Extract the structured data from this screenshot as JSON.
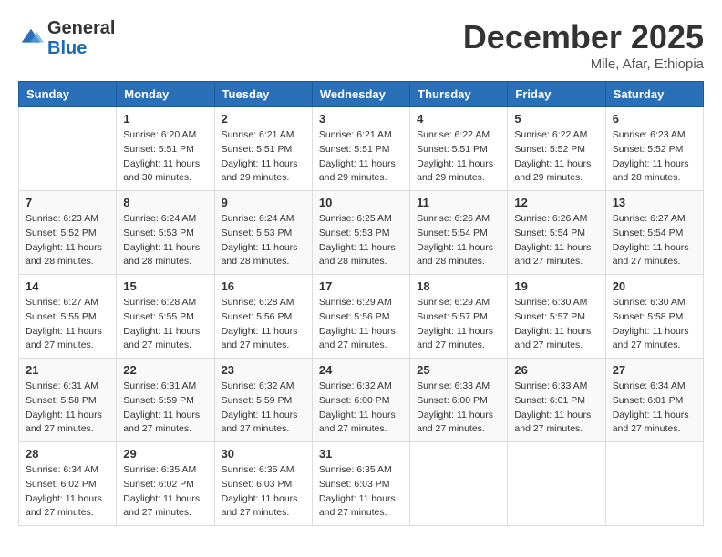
{
  "header": {
    "logo_general": "General",
    "logo_blue": "Blue",
    "month_title": "December 2025",
    "location": "Mile, Afar, Ethiopia"
  },
  "days_of_week": [
    "Sunday",
    "Monday",
    "Tuesday",
    "Wednesday",
    "Thursday",
    "Friday",
    "Saturday"
  ],
  "weeks": [
    [
      {
        "day": "",
        "sunrise": "",
        "sunset": "",
        "daylight": ""
      },
      {
        "day": "1",
        "sunrise": "Sunrise: 6:20 AM",
        "sunset": "Sunset: 5:51 PM",
        "daylight": "Daylight: 11 hours and 30 minutes."
      },
      {
        "day": "2",
        "sunrise": "Sunrise: 6:21 AM",
        "sunset": "Sunset: 5:51 PM",
        "daylight": "Daylight: 11 hours and 29 minutes."
      },
      {
        "day": "3",
        "sunrise": "Sunrise: 6:21 AM",
        "sunset": "Sunset: 5:51 PM",
        "daylight": "Daylight: 11 hours and 29 minutes."
      },
      {
        "day": "4",
        "sunrise": "Sunrise: 6:22 AM",
        "sunset": "Sunset: 5:51 PM",
        "daylight": "Daylight: 11 hours and 29 minutes."
      },
      {
        "day": "5",
        "sunrise": "Sunrise: 6:22 AM",
        "sunset": "Sunset: 5:52 PM",
        "daylight": "Daylight: 11 hours and 29 minutes."
      },
      {
        "day": "6",
        "sunrise": "Sunrise: 6:23 AM",
        "sunset": "Sunset: 5:52 PM",
        "daylight": "Daylight: 11 hours and 28 minutes."
      }
    ],
    [
      {
        "day": "7",
        "sunrise": "Sunrise: 6:23 AM",
        "sunset": "Sunset: 5:52 PM",
        "daylight": "Daylight: 11 hours and 28 minutes."
      },
      {
        "day": "8",
        "sunrise": "Sunrise: 6:24 AM",
        "sunset": "Sunset: 5:53 PM",
        "daylight": "Daylight: 11 hours and 28 minutes."
      },
      {
        "day": "9",
        "sunrise": "Sunrise: 6:24 AM",
        "sunset": "Sunset: 5:53 PM",
        "daylight": "Daylight: 11 hours and 28 minutes."
      },
      {
        "day": "10",
        "sunrise": "Sunrise: 6:25 AM",
        "sunset": "Sunset: 5:53 PM",
        "daylight": "Daylight: 11 hours and 28 minutes."
      },
      {
        "day": "11",
        "sunrise": "Sunrise: 6:26 AM",
        "sunset": "Sunset: 5:54 PM",
        "daylight": "Daylight: 11 hours and 28 minutes."
      },
      {
        "day": "12",
        "sunrise": "Sunrise: 6:26 AM",
        "sunset": "Sunset: 5:54 PM",
        "daylight": "Daylight: 11 hours and 27 minutes."
      },
      {
        "day": "13",
        "sunrise": "Sunrise: 6:27 AM",
        "sunset": "Sunset: 5:54 PM",
        "daylight": "Daylight: 11 hours and 27 minutes."
      }
    ],
    [
      {
        "day": "14",
        "sunrise": "Sunrise: 6:27 AM",
        "sunset": "Sunset: 5:55 PM",
        "daylight": "Daylight: 11 hours and 27 minutes."
      },
      {
        "day": "15",
        "sunrise": "Sunrise: 6:28 AM",
        "sunset": "Sunset: 5:55 PM",
        "daylight": "Daylight: 11 hours and 27 minutes."
      },
      {
        "day": "16",
        "sunrise": "Sunrise: 6:28 AM",
        "sunset": "Sunset: 5:56 PM",
        "daylight": "Daylight: 11 hours and 27 minutes."
      },
      {
        "day": "17",
        "sunrise": "Sunrise: 6:29 AM",
        "sunset": "Sunset: 5:56 PM",
        "daylight": "Daylight: 11 hours and 27 minutes."
      },
      {
        "day": "18",
        "sunrise": "Sunrise: 6:29 AM",
        "sunset": "Sunset: 5:57 PM",
        "daylight": "Daylight: 11 hours and 27 minutes."
      },
      {
        "day": "19",
        "sunrise": "Sunrise: 6:30 AM",
        "sunset": "Sunset: 5:57 PM",
        "daylight": "Daylight: 11 hours and 27 minutes."
      },
      {
        "day": "20",
        "sunrise": "Sunrise: 6:30 AM",
        "sunset": "Sunset: 5:58 PM",
        "daylight": "Daylight: 11 hours and 27 minutes."
      }
    ],
    [
      {
        "day": "21",
        "sunrise": "Sunrise: 6:31 AM",
        "sunset": "Sunset: 5:58 PM",
        "daylight": "Daylight: 11 hours and 27 minutes."
      },
      {
        "day": "22",
        "sunrise": "Sunrise: 6:31 AM",
        "sunset": "Sunset: 5:59 PM",
        "daylight": "Daylight: 11 hours and 27 minutes."
      },
      {
        "day": "23",
        "sunrise": "Sunrise: 6:32 AM",
        "sunset": "Sunset: 5:59 PM",
        "daylight": "Daylight: 11 hours and 27 minutes."
      },
      {
        "day": "24",
        "sunrise": "Sunrise: 6:32 AM",
        "sunset": "Sunset: 6:00 PM",
        "daylight": "Daylight: 11 hours and 27 minutes."
      },
      {
        "day": "25",
        "sunrise": "Sunrise: 6:33 AM",
        "sunset": "Sunset: 6:00 PM",
        "daylight": "Daylight: 11 hours and 27 minutes."
      },
      {
        "day": "26",
        "sunrise": "Sunrise: 6:33 AM",
        "sunset": "Sunset: 6:01 PM",
        "daylight": "Daylight: 11 hours and 27 minutes."
      },
      {
        "day": "27",
        "sunrise": "Sunrise: 6:34 AM",
        "sunset": "Sunset: 6:01 PM",
        "daylight": "Daylight: 11 hours and 27 minutes."
      }
    ],
    [
      {
        "day": "28",
        "sunrise": "Sunrise: 6:34 AM",
        "sunset": "Sunset: 6:02 PM",
        "daylight": "Daylight: 11 hours and 27 minutes."
      },
      {
        "day": "29",
        "sunrise": "Sunrise: 6:35 AM",
        "sunset": "Sunset: 6:02 PM",
        "daylight": "Daylight: 11 hours and 27 minutes."
      },
      {
        "day": "30",
        "sunrise": "Sunrise: 6:35 AM",
        "sunset": "Sunset: 6:03 PM",
        "daylight": "Daylight: 11 hours and 27 minutes."
      },
      {
        "day": "31",
        "sunrise": "Sunrise: 6:35 AM",
        "sunset": "Sunset: 6:03 PM",
        "daylight": "Daylight: 11 hours and 27 minutes."
      },
      {
        "day": "",
        "sunrise": "",
        "sunset": "",
        "daylight": ""
      },
      {
        "day": "",
        "sunrise": "",
        "sunset": "",
        "daylight": ""
      },
      {
        "day": "",
        "sunrise": "",
        "sunset": "",
        "daylight": ""
      }
    ]
  ]
}
